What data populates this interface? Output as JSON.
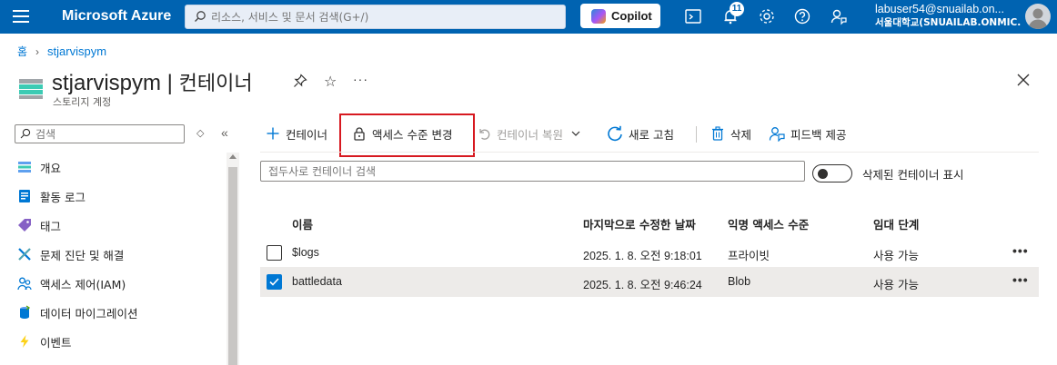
{
  "topbar": {
    "brand": "Microsoft Azure",
    "search_placeholder": "리소스, 서비스 및 문서 검색(G+/)",
    "copilot_label": "Copilot",
    "notification_count": "11",
    "user_email": "labuser54@snuailab.on...",
    "user_tenant": "서울대학교(SNUAILAB.ONMIC...",
    "bg_color": "#0063b1"
  },
  "breadcrumb": {
    "home": "홈",
    "resource": "stjarvispym"
  },
  "header": {
    "title_resource": "stjarvispym",
    "title_sep": " | ",
    "title_page": "컨테이너",
    "subtitle": "스토리지 계정",
    "ellipsis": "···",
    "star": "☆"
  },
  "nav": {
    "search_placeholder": "검색",
    "arrows": "◇",
    "collapse": "«",
    "items": [
      {
        "label": "개요",
        "icon": "overview-icon"
      },
      {
        "label": "활동 로그",
        "icon": "activity-log-icon"
      },
      {
        "label": "태그",
        "icon": "tag-icon"
      },
      {
        "label": "문제 진단 및 해결",
        "icon": "diagnose-icon"
      },
      {
        "label": "액세스 제어(IAM)",
        "icon": "iam-icon"
      },
      {
        "label": "데이터 마이그레이션",
        "icon": "data-migration-icon"
      },
      {
        "label": "이벤트",
        "icon": "events-icon"
      }
    ]
  },
  "toolbar": {
    "add_container": "컨테이너",
    "change_access": "액세스 수준 변경",
    "restore_container": "컨테이너 복원",
    "refresh": "새로 고침",
    "delete": "삭제",
    "feedback": "피드백 제공",
    "highlight_color": "#d71920"
  },
  "filter": {
    "placeholder": "접두사로 컨테이너 검색",
    "toggle_label": "삭제된 컨테이너 표시",
    "toggle_on": false
  },
  "table": {
    "columns": [
      "이름",
      "마지막으로 수정한 날짜",
      "익명 액세스 수준",
      "임대 단계"
    ],
    "rows": [
      {
        "name": "$logs",
        "modified": "2025. 1. 8. 오전 9:18:01",
        "access": "프라이빗",
        "lease": "사용 가능",
        "selected": false
      },
      {
        "name": "battledata",
        "modified": "2025. 1. 8. 오전 9:46:24",
        "access": "Blob",
        "lease": "사용 가능",
        "selected": true
      }
    ],
    "row_more": "•••"
  }
}
